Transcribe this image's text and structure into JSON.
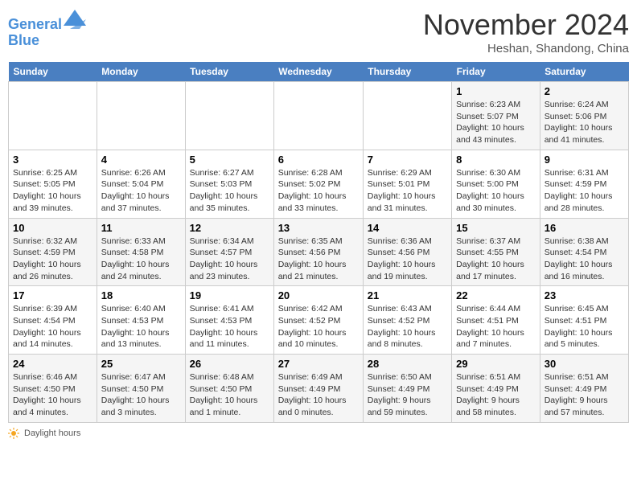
{
  "header": {
    "logo_line1": "General",
    "logo_line2": "Blue",
    "month_title": "November 2024",
    "subtitle": "Heshan, Shandong, China"
  },
  "days_of_week": [
    "Sunday",
    "Monday",
    "Tuesday",
    "Wednesday",
    "Thursday",
    "Friday",
    "Saturday"
  ],
  "weeks": [
    {
      "days": [
        {
          "num": "",
          "info": ""
        },
        {
          "num": "",
          "info": ""
        },
        {
          "num": "",
          "info": ""
        },
        {
          "num": "",
          "info": ""
        },
        {
          "num": "",
          "info": ""
        },
        {
          "num": "1",
          "info": "Sunrise: 6:23 AM\nSunset: 5:07 PM\nDaylight: 10 hours\nand 43 minutes."
        },
        {
          "num": "2",
          "info": "Sunrise: 6:24 AM\nSunset: 5:06 PM\nDaylight: 10 hours\nand 41 minutes."
        }
      ]
    },
    {
      "days": [
        {
          "num": "3",
          "info": "Sunrise: 6:25 AM\nSunset: 5:05 PM\nDaylight: 10 hours\nand 39 minutes."
        },
        {
          "num": "4",
          "info": "Sunrise: 6:26 AM\nSunset: 5:04 PM\nDaylight: 10 hours\nand 37 minutes."
        },
        {
          "num": "5",
          "info": "Sunrise: 6:27 AM\nSunset: 5:03 PM\nDaylight: 10 hours\nand 35 minutes."
        },
        {
          "num": "6",
          "info": "Sunrise: 6:28 AM\nSunset: 5:02 PM\nDaylight: 10 hours\nand 33 minutes."
        },
        {
          "num": "7",
          "info": "Sunrise: 6:29 AM\nSunset: 5:01 PM\nDaylight: 10 hours\nand 31 minutes."
        },
        {
          "num": "8",
          "info": "Sunrise: 6:30 AM\nSunset: 5:00 PM\nDaylight: 10 hours\nand 30 minutes."
        },
        {
          "num": "9",
          "info": "Sunrise: 6:31 AM\nSunset: 4:59 PM\nDaylight: 10 hours\nand 28 minutes."
        }
      ]
    },
    {
      "days": [
        {
          "num": "10",
          "info": "Sunrise: 6:32 AM\nSunset: 4:59 PM\nDaylight: 10 hours\nand 26 minutes."
        },
        {
          "num": "11",
          "info": "Sunrise: 6:33 AM\nSunset: 4:58 PM\nDaylight: 10 hours\nand 24 minutes."
        },
        {
          "num": "12",
          "info": "Sunrise: 6:34 AM\nSunset: 4:57 PM\nDaylight: 10 hours\nand 23 minutes."
        },
        {
          "num": "13",
          "info": "Sunrise: 6:35 AM\nSunset: 4:56 PM\nDaylight: 10 hours\nand 21 minutes."
        },
        {
          "num": "14",
          "info": "Sunrise: 6:36 AM\nSunset: 4:56 PM\nDaylight: 10 hours\nand 19 minutes."
        },
        {
          "num": "15",
          "info": "Sunrise: 6:37 AM\nSunset: 4:55 PM\nDaylight: 10 hours\nand 17 minutes."
        },
        {
          "num": "16",
          "info": "Sunrise: 6:38 AM\nSunset: 4:54 PM\nDaylight: 10 hours\nand 16 minutes."
        }
      ]
    },
    {
      "days": [
        {
          "num": "17",
          "info": "Sunrise: 6:39 AM\nSunset: 4:54 PM\nDaylight: 10 hours\nand 14 minutes."
        },
        {
          "num": "18",
          "info": "Sunrise: 6:40 AM\nSunset: 4:53 PM\nDaylight: 10 hours\nand 13 minutes."
        },
        {
          "num": "19",
          "info": "Sunrise: 6:41 AM\nSunset: 4:53 PM\nDaylight: 10 hours\nand 11 minutes."
        },
        {
          "num": "20",
          "info": "Sunrise: 6:42 AM\nSunset: 4:52 PM\nDaylight: 10 hours\nand 10 minutes."
        },
        {
          "num": "21",
          "info": "Sunrise: 6:43 AM\nSunset: 4:52 PM\nDaylight: 10 hours\nand 8 minutes."
        },
        {
          "num": "22",
          "info": "Sunrise: 6:44 AM\nSunset: 4:51 PM\nDaylight: 10 hours\nand 7 minutes."
        },
        {
          "num": "23",
          "info": "Sunrise: 6:45 AM\nSunset: 4:51 PM\nDaylight: 10 hours\nand 5 minutes."
        }
      ]
    },
    {
      "days": [
        {
          "num": "24",
          "info": "Sunrise: 6:46 AM\nSunset: 4:50 PM\nDaylight: 10 hours\nand 4 minutes."
        },
        {
          "num": "25",
          "info": "Sunrise: 6:47 AM\nSunset: 4:50 PM\nDaylight: 10 hours\nand 3 minutes."
        },
        {
          "num": "26",
          "info": "Sunrise: 6:48 AM\nSunset: 4:50 PM\nDaylight: 10 hours\nand 1 minute."
        },
        {
          "num": "27",
          "info": "Sunrise: 6:49 AM\nSunset: 4:49 PM\nDaylight: 10 hours\nand 0 minutes."
        },
        {
          "num": "28",
          "info": "Sunrise: 6:50 AM\nSunset: 4:49 PM\nDaylight: 9 hours\nand 59 minutes."
        },
        {
          "num": "29",
          "info": "Sunrise: 6:51 AM\nSunset: 4:49 PM\nDaylight: 9 hours\nand 58 minutes."
        },
        {
          "num": "30",
          "info": "Sunrise: 6:51 AM\nSunset: 4:49 PM\nDaylight: 9 hours\nand 57 minutes."
        }
      ]
    }
  ],
  "footer": {
    "daylight_label": "Daylight hours"
  }
}
